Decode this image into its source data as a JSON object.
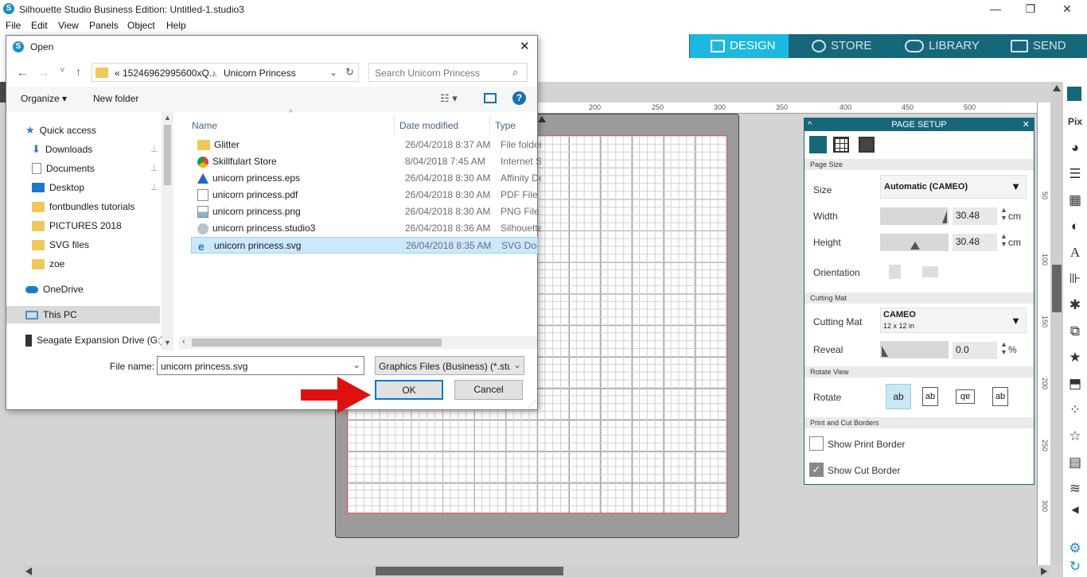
{
  "window": {
    "title": "Silhouette Studio Business Edition: Untitled-1.studio3",
    "minimize": "—",
    "restore": "❐",
    "close": "✕"
  },
  "menu": [
    "File",
    "Edit",
    "View",
    "Panels",
    "Object",
    "Help"
  ],
  "nav_tabs": [
    {
      "label": "DESIGN",
      "active": true
    },
    {
      "label": "STORE"
    },
    {
      "label": "LIBRARY"
    },
    {
      "label": "SEND"
    }
  ],
  "ruler": {
    "top": [
      "200",
      "250",
      "300",
      "350",
      "400",
      "450",
      "500"
    ],
    "right": [
      "50",
      "100",
      "150",
      "200",
      "250",
      "300"
    ]
  },
  "page_setup": {
    "title": "PAGE SETUP",
    "sections": {
      "page_size": "Page Size",
      "cutting_mat": "Cutting Mat",
      "rotate_view": "Rotate View",
      "borders": "Print and Cut Borders"
    },
    "size_label": "Size",
    "size_value": "Automatic (CAMEO)",
    "width_label": "Width",
    "width_value": "30.48",
    "width_unit": "cm",
    "height_label": "Height",
    "height_value": "30.48",
    "height_unit": "cm",
    "orientation_label": "Orientation",
    "mat_label": "Cutting Mat",
    "mat_value": "CAMEO",
    "mat_sub": "12 x 12 in",
    "reveal_label": "Reveal",
    "reveal_value": "0.0",
    "reveal_unit": "%",
    "rotate_label": "Rotate",
    "rotate_options": [
      "ab",
      "ab",
      "ab",
      "ab"
    ],
    "print_border": {
      "label": "Show Print Border",
      "checked": false
    },
    "cut_border": {
      "label": "Show Cut Border",
      "checked": true
    }
  },
  "dialog": {
    "title": "Open",
    "breadcrumb": [
      "«  15246962995600xQ...",
      "Unicorn Princess"
    ],
    "search_placeholder": "Search Unicorn Princess",
    "organize": "Organize ▾",
    "new_folder": "New folder",
    "nav": [
      {
        "label": "Quick access",
        "icon": "star-icon"
      },
      {
        "label": "Downloads",
        "icon": "download-icon",
        "pinned": true
      },
      {
        "label": "Documents",
        "icon": "documents-icon",
        "pinned": true
      },
      {
        "label": "Desktop",
        "icon": "desktop-icon",
        "pinned": true
      },
      {
        "label": "fontbundles tutorials",
        "icon": "folder-icon"
      },
      {
        "label": "PICTURES 2018",
        "icon": "folder-icon"
      },
      {
        "label": "SVG files",
        "icon": "folder-icon"
      },
      {
        "label": "zoe",
        "icon": "folder-icon"
      },
      {
        "label": "OneDrive",
        "icon": "cloud-icon"
      },
      {
        "label": "This PC",
        "icon": "computer-icon",
        "selected": true
      },
      {
        "label": "Seagate Expansion Drive (G:)",
        "icon": "drive-icon"
      }
    ],
    "columns": [
      "Name",
      "Date modified",
      "Type"
    ],
    "files": [
      {
        "name": "Glitter",
        "date": "26/04/2018 8:37 AM",
        "type": "File folder",
        "icon": "folder-icon"
      },
      {
        "name": "Skillfulart Store",
        "date": "8/04/2018 7:45 AM",
        "type": "Internet Sh",
        "icon": "chrome-icon"
      },
      {
        "name": "unicorn princess.eps",
        "date": "26/04/2018 8:30 AM",
        "type": "Affinity De",
        "icon": "affinity-icon"
      },
      {
        "name": "unicorn princess.pdf",
        "date": "26/04/2018 8:30 AM",
        "type": "PDF File",
        "icon": "pdf-icon"
      },
      {
        "name": "unicorn princess.png",
        "date": "26/04/2018 8:30 AM",
        "type": "PNG File",
        "icon": "image-icon"
      },
      {
        "name": "unicorn princess.studio3",
        "date": "26/04/2018 8:36 AM",
        "type": "Silhouette",
        "icon": "silhouette-icon"
      },
      {
        "name": "unicorn princess.svg",
        "date": "26/04/2018 8:35 AM",
        "type": "SVG Docu",
        "icon": "ie-icon",
        "selected": true
      }
    ],
    "filename_label": "File name:",
    "filename_value": "unicorn princess.svg",
    "filter_value": "Graphics Files (Business) (*.stuc",
    "ok": "OK",
    "cancel": "Cancel"
  },
  "colors": {
    "accent": "#1cb8e0",
    "nav_strip": "#17677b",
    "arrow": "#e01010",
    "selection": "#cce8ff"
  }
}
